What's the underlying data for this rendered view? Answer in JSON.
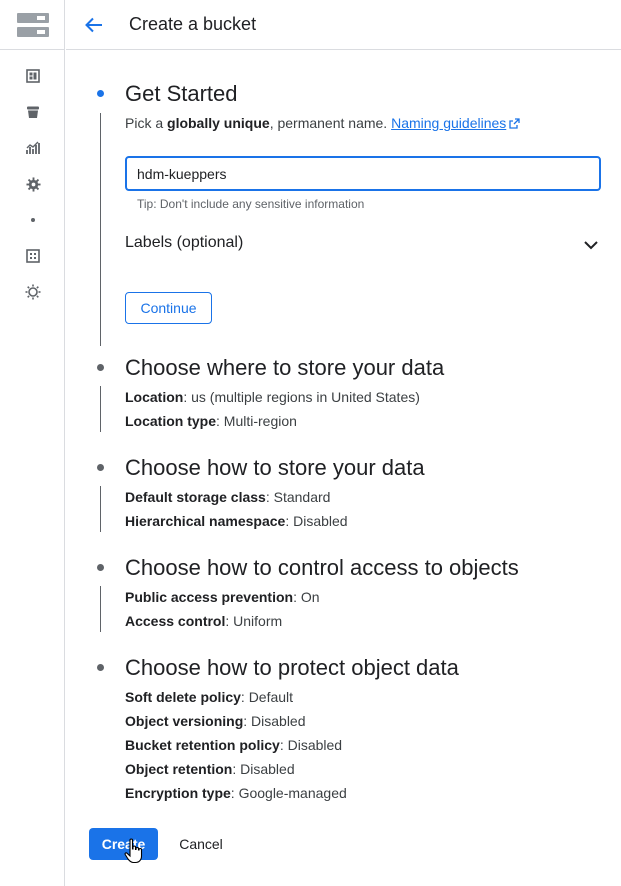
{
  "header": {
    "title": "Create a bucket"
  },
  "colors": {
    "accent": "#1a73e8",
    "muted": "#5f6368",
    "text": "#202124"
  },
  "rail_icons": [
    "storage-logo-icon",
    "dashboard-icon",
    "bucket-icon",
    "monitoring-icon",
    "settings-icon",
    "dot-icon",
    "grid-icon",
    "sun-icon"
  ],
  "step1": {
    "title": "Get Started",
    "subtitle_pre": "Pick a ",
    "subtitle_bold": "globally unique",
    "subtitle_post": ", permanent name.",
    "naming_link": "Naming guidelines",
    "name_value": "hdm-kueppers",
    "tip": "Tip: Don't include any sensitive information",
    "labels": "Labels (optional)",
    "continue": "Continue"
  },
  "step2": {
    "title": "Choose where to store your data",
    "rows": [
      {
        "label": "Location",
        "value": ": us (multiple regions in United States)"
      },
      {
        "label": "Location type",
        "value": ": Multi-region"
      }
    ]
  },
  "step3": {
    "title": "Choose how to store your data",
    "rows": [
      {
        "label": "Default storage class",
        "value": ": Standard"
      },
      {
        "label": "Hierarchical namespace",
        "value": ": Disabled"
      }
    ]
  },
  "step4": {
    "title": "Choose how to control access to objects",
    "rows": [
      {
        "label": "Public access prevention",
        "value": ": On"
      },
      {
        "label": "Access control",
        "value": ": Uniform"
      }
    ]
  },
  "step5": {
    "title": "Choose how to protect object data",
    "rows": [
      {
        "label": "Soft delete policy",
        "value": ": Default"
      },
      {
        "label": "Object versioning",
        "value": ": Disabled"
      },
      {
        "label": "Bucket retention policy",
        "value": ": Disabled"
      },
      {
        "label": "Object retention",
        "value": ": Disabled"
      },
      {
        "label": "Encryption type",
        "value": ": Google-managed"
      }
    ]
  },
  "actions": {
    "create": "Create",
    "cancel": "Cancel"
  }
}
